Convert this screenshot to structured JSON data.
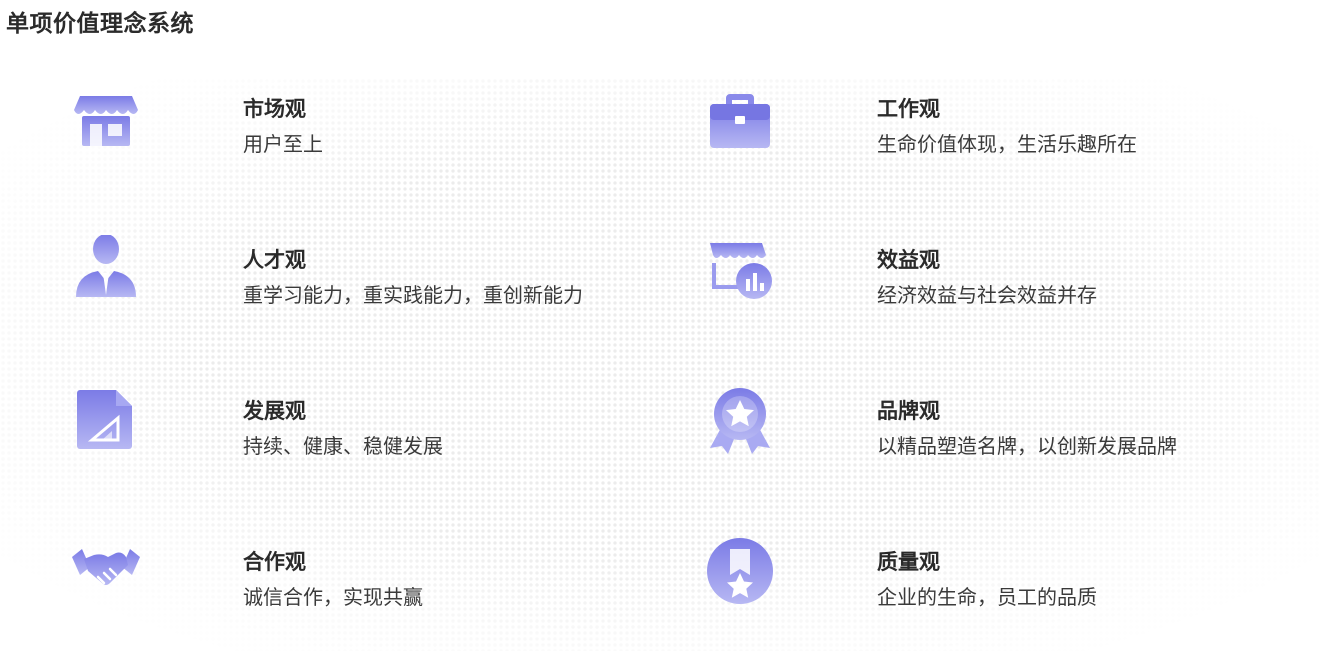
{
  "page": {
    "title": "单项价值理念系统"
  },
  "brand": {
    "icon_color_light": "#b7b8f3",
    "icon_color_dark": "#7b7be6"
  },
  "items": [
    {
      "icon": "storefront-icon",
      "title": "市场观",
      "desc": "用户至上"
    },
    {
      "icon": "briefcase-icon",
      "title": "工作观",
      "desc": "生命价值体现，生活乐趣所在"
    },
    {
      "icon": "person-icon",
      "title": "人才观",
      "desc": "重学习能力，重实践能力，重创新能力"
    },
    {
      "icon": "shop-chart-icon",
      "title": "效益观",
      "desc": "经济效益与社会效益并存"
    },
    {
      "icon": "document-ruler-icon",
      "title": "发展观",
      "desc": "持续、健康、稳健发展"
    },
    {
      "icon": "award-badge-icon",
      "title": "品牌观",
      "desc": "以精品塑造名牌，以创新发展品牌"
    },
    {
      "icon": "handshake-icon",
      "title": "合作观",
      "desc": "诚信合作，实现共赢"
    },
    {
      "icon": "medal-star-icon",
      "title": "质量观",
      "desc": "企业的生命，员工的品质"
    }
  ]
}
